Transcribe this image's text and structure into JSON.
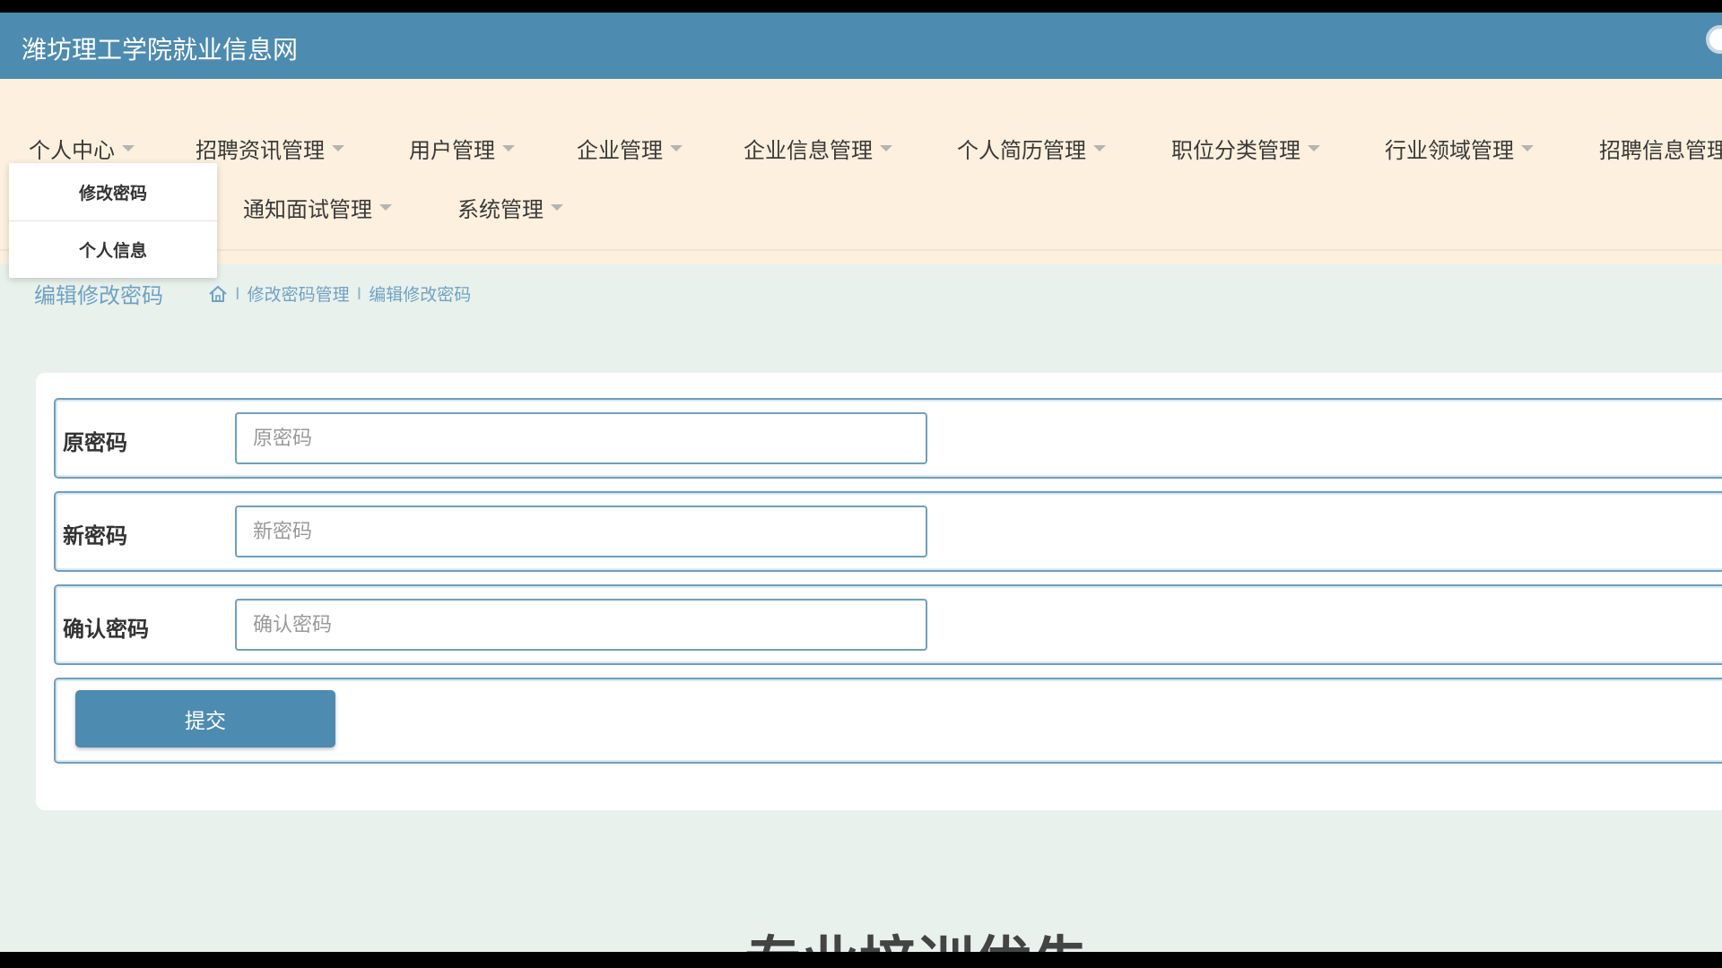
{
  "header": {
    "site_title": "潍坊理工学院就业信息网"
  },
  "nav": {
    "items": [
      {
        "label": "个人中心"
      },
      {
        "label": "招聘资讯管理"
      },
      {
        "label": "用户管理"
      },
      {
        "label": "企业管理"
      },
      {
        "label": "企业信息管理"
      },
      {
        "label": "个人简历管理"
      },
      {
        "label": "职位分类管理"
      },
      {
        "label": "行业领域管理"
      },
      {
        "label": "招聘信息管理"
      },
      {
        "label": "通知面试管理"
      },
      {
        "label": "系统管理"
      }
    ],
    "dropdown": [
      {
        "label": "修改密码"
      },
      {
        "label": "个人信息"
      }
    ]
  },
  "breadcrumb": {
    "page_title": "编辑修改密码",
    "items": [
      "修改密码管理",
      "编辑修改密码"
    ],
    "separator": "I",
    "home_icon": "home-icon"
  },
  "form": {
    "fields": [
      {
        "label": "原密码",
        "placeholder": "原密码",
        "value": ""
      },
      {
        "label": "新密码",
        "placeholder": "新密码",
        "value": ""
      },
      {
        "label": "确认密码",
        "placeholder": "确认密码",
        "value": ""
      }
    ],
    "submit_label": "提交"
  },
  "footer": {
    "partial_text": "专业培训优先"
  },
  "colors": {
    "header_bg": "#4e8bb0",
    "nav_bg": "#fdf0de",
    "accent": "#6fa2c4",
    "page_bg": "#e9f1ec"
  }
}
